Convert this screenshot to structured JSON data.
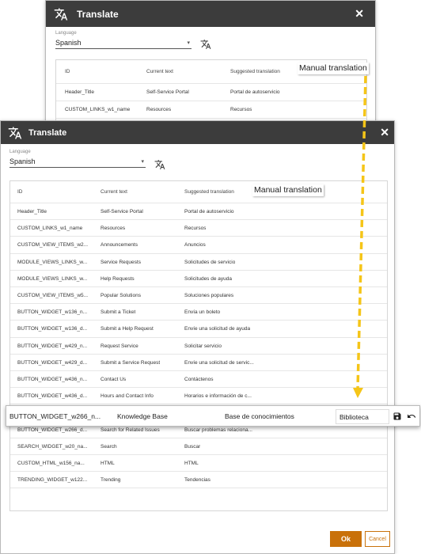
{
  "back_dialog": {
    "title": "Translate",
    "language_label": "Language",
    "language_value": "Spanish",
    "headers": {
      "id": "ID",
      "current": "Current text",
      "suggested": "Suggested translation"
    },
    "rows": [
      {
        "id": "Header_Title",
        "current": "Self-Service Portal",
        "suggested": "Portal de autoservicio"
      },
      {
        "id": "CUSTOM_LINKS_w1_name",
        "current": "Resources",
        "suggested": "Recursos"
      }
    ]
  },
  "front_dialog": {
    "title": "Translate",
    "language_label": "Language",
    "language_value": "Spanish",
    "headers": {
      "id": "ID",
      "current": "Current text",
      "suggested": "Suggested translation"
    },
    "rows_top": [
      {
        "id": "Header_Title",
        "current": "Self-Service Portal",
        "suggested": "Portal de autoservicio"
      },
      {
        "id": "CUSTOM_LINKS_w1_name",
        "current": "Resources",
        "suggested": "Recursos"
      },
      {
        "id": "CUSTOM_VIEW_ITEMS_w2...",
        "current": "Announcements",
        "suggested": "Anuncios"
      },
      {
        "id": "MODULE_VIEWS_LINKS_w...",
        "current": "Service Requests",
        "suggested": "Solicitudes de servicio"
      },
      {
        "id": "MODULE_VIEWS_LINKS_w...",
        "current": "Help Requests",
        "suggested": "Solicitudes de ayuda"
      },
      {
        "id": "CUSTOM_VIEW_ITEMS_w5...",
        "current": "Popular Solutions",
        "suggested": "Soluciones populares"
      },
      {
        "id": "BUTTON_WIDGET_w136_n...",
        "current": "Submit a Ticket",
        "suggested": "Envía un boleto"
      },
      {
        "id": "BUTTON_WIDGET_w136_d...",
        "current": "Submit a Help Request",
        "suggested": "Envíe una solicitud de ayuda"
      },
      {
        "id": "BUTTON_WIDGET_w429_n...",
        "current": "Request Service",
        "suggested": "Solicitar servicio"
      },
      {
        "id": "BUTTON_WIDGET_w429_d...",
        "current": "Submit a Service Request",
        "suggested": "Envíe una solicitud de servic..."
      },
      {
        "id": "BUTTON_WIDGET_w436_n...",
        "current": "Contact Us",
        "suggested": "Contáctenos"
      },
      {
        "id": "BUTTON_WIDGET_w436_d...",
        "current": "Hours and Contact Info",
        "suggested": "Horarios e información de c..."
      }
    ],
    "rows_bottom": [
      {
        "id": "BUTTON_WIDGET_w266_d...",
        "current": "Search for Related Issues",
        "suggested": "Buscar problemas relaciona..."
      },
      {
        "id": "SEARCH_WIDGET_w20_na...",
        "current": "Search",
        "suggested": "Buscar"
      },
      {
        "id": "CUSTOM_HTML_w156_na...",
        "current": "HTML",
        "suggested": "HTML"
      },
      {
        "id": "TRENDING_WIDGET_w122...",
        "current": "Trending",
        "suggested": "Tendencias"
      }
    ],
    "editing_row": {
      "id": "BUTTON_WIDGET_w266_n...",
      "current": "Knowledge Base",
      "suggested": "Base de conocimientos",
      "manual_value": "Biblioteca"
    },
    "ok_label": "Ok",
    "cancel_label": "Cancel"
  },
  "callouts": {
    "back": "Manual translation",
    "front": "Manual translation"
  },
  "colors": {
    "titlebar": "#3c3c3c",
    "accent": "#c9710a",
    "arrow": "#f5c518"
  }
}
